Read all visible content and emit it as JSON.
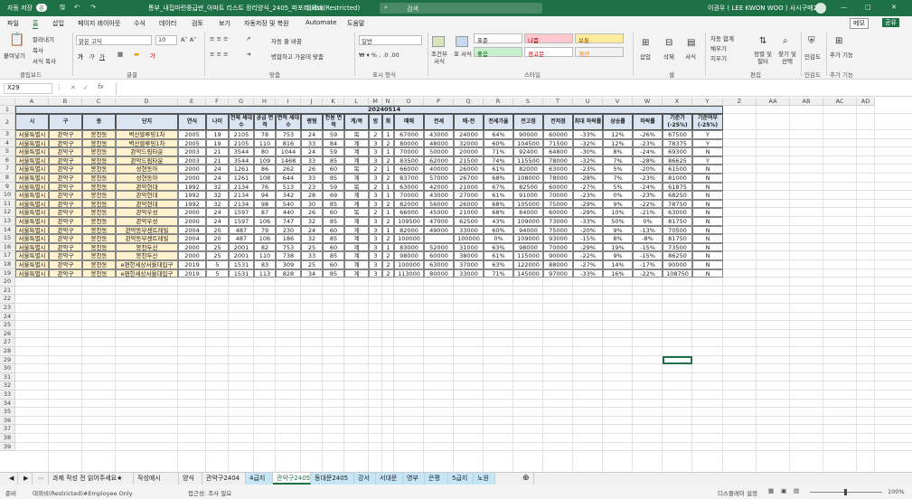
{
  "titlebar": {
    "autosave": "자동 저장",
    "autosave_state": "끔",
    "filename": "통부_내집마련중급반_아파트 리스트 정리양식_2405_파포리.xlsx",
    "label": "대외비(Restricted)",
    "search": "검색",
    "user": "이권우 ( LEE KWON WOO ) 사시구매2팀"
  },
  "tabs": [
    "파일",
    "홈",
    "삽입",
    "페이지 레이아웃",
    "수식",
    "데이터",
    "검토",
    "보기",
    "자동저장 및 복원",
    "Automate",
    "도움말"
  ],
  "tab_right": {
    "memo": "메모",
    "share": "공유"
  },
  "ribbon": {
    "paste": "붙여넣기",
    "cut": "잘라내기",
    "copy": "복사",
    "format_painter": "서식 복사",
    "font": "맑은 고딕",
    "font_size": "10",
    "wrap": "자동 줄 바꿈",
    "merge": "병합하고 가운데 맞춤",
    "number_format": "일반",
    "cond_format": "조건부 서식",
    "table_format": "표 서식",
    "cell_styles": [
      "표준",
      "나쁨",
      "보통",
      "좋음",
      "경고문",
      "계산"
    ],
    "insert": "삽입",
    "delete": "삭제",
    "format": "서식",
    "autosum": "자동 합계",
    "fill": "채우기",
    "clear": "지우기",
    "sort": "정렬 및 필터",
    "find": "찾기 및 선택",
    "sensitivity": "민감도",
    "addins": "추가 기능",
    "groups": [
      "클립보드",
      "글꼴",
      "맞춤",
      "표시 형식",
      "스타일",
      "셀",
      "편집",
      "민감도",
      "추가 기능"
    ]
  },
  "formula": {
    "namebox": "X29",
    "fx": "fx"
  },
  "columns": [
    "A",
    "B",
    "C",
    "D",
    "E",
    "F",
    "G",
    "H",
    "I",
    "J",
    "K",
    "L",
    "M",
    "N",
    "O",
    "P",
    "Q",
    "R",
    "S",
    "T",
    "U",
    "V",
    "W",
    "X",
    "Y",
    "Z",
    "AA",
    "AB",
    "AC",
    "AD"
  ],
  "rows": [
    "1",
    "2",
    "3",
    "4",
    "5",
    "6",
    "7",
    "8",
    "9",
    "10",
    "11",
    "12",
    "13",
    "14",
    "15",
    "16",
    "17",
    "18",
    "19",
    "20",
    "21",
    "22",
    "23",
    "24",
    "25",
    "26",
    "27",
    "28",
    "29",
    "30",
    "31",
    "32",
    "33",
    "34",
    "35",
    "36",
    "37",
    "38",
    "39"
  ],
  "date": "20240514",
  "header": [
    "시",
    "구",
    "동",
    "단지",
    "연식",
    "나이",
    "전체 세대수",
    "공급 면적",
    "면적 세대수",
    "평형",
    "전용 면적",
    "계/복",
    "방",
    "화",
    "매매",
    "전세",
    "매-전",
    "전세가율",
    "전고점",
    "전저점",
    "최대 하락률",
    "상승률",
    "하락률",
    "기준가 (-25%)",
    "기준여부 (-25%)"
  ],
  "data": [
    [
      "서울특별시",
      "관악구",
      "봉천동",
      "벽산블루밍1차",
      "2005",
      "19",
      "2105",
      "78",
      "753",
      "24",
      "59",
      "복",
      "2",
      "1",
      "67000",
      "43000",
      "24000",
      "64%",
      "90000",
      "60000",
      "-33%",
      "12%",
      "-26%",
      "67500",
      "Y"
    ],
    [
      "서울특별시",
      "관악구",
      "봉천동",
      "벽산블루밍1차",
      "2005",
      "19",
      "2105",
      "110",
      "816",
      "33",
      "84",
      "계",
      "3",
      "2",
      "80000",
      "48000",
      "32000",
      "60%",
      "104500",
      "71500",
      "-32%",
      "12%",
      "-23%",
      "78375",
      "Y"
    ],
    [
      "서울특별시",
      "관악구",
      "봉천동",
      "관악드림타운",
      "2003",
      "21",
      "3544",
      "80",
      "1044",
      "24",
      "59",
      "계",
      "3",
      "1",
      "70000",
      "50000",
      "20000",
      "71%",
      "92400",
      "64800",
      "-30%",
      "8%",
      "-24%",
      "69300",
      "N"
    ],
    [
      "서울특별시",
      "관악구",
      "봉천동",
      "관악드림타운",
      "2003",
      "21",
      "3544",
      "109",
      "1468",
      "33",
      "85",
      "계",
      "3",
      "2",
      "83500",
      "62000",
      "21500",
      "74%",
      "115500",
      "78000",
      "-32%",
      "7%",
      "-28%",
      "86625",
      "Y"
    ],
    [
      "서울특별시",
      "관악구",
      "봉천동",
      "성현동아",
      "2000",
      "24",
      "1261",
      "86",
      "262",
      "26",
      "60",
      "복",
      "2",
      "1",
      "66000",
      "40000",
      "26000",
      "61%",
      "82000",
      "63000",
      "-23%",
      "5%",
      "-20%",
      "61500",
      "N"
    ],
    [
      "서울특별시",
      "관악구",
      "봉천동",
      "성현동아",
      "2000",
      "24",
      "1261",
      "108",
      "644",
      "33",
      "85",
      "계",
      "3",
      "2",
      "83700",
      "57000",
      "26700",
      "68%",
      "108000",
      "78000",
      "-28%",
      "7%",
      "-23%",
      "81000",
      "N"
    ],
    [
      "서울특별시",
      "관악구",
      "봉천동",
      "관악현대",
      "1992",
      "32",
      "2134",
      "76",
      "513",
      "23",
      "59",
      "복",
      "2",
      "1",
      "63000",
      "42000",
      "21000",
      "67%",
      "82500",
      "60000",
      "-27%",
      "5%",
      "-24%",
      "61875",
      "N"
    ],
    [
      "서울특별시",
      "관악구",
      "봉천동",
      "관악현대",
      "1992",
      "32",
      "2134",
      "94",
      "342",
      "28",
      "69",
      "계",
      "3",
      "1",
      "70000",
      "43000",
      "27000",
      "61%",
      "91000",
      "70000",
      "-23%",
      "0%",
      "-23%",
      "68250",
      "N"
    ],
    [
      "서울특별시",
      "관악구",
      "봉천동",
      "관악현대",
      "1992",
      "32",
      "2134",
      "98",
      "540",
      "30",
      "85",
      "계",
      "3",
      "2",
      "82000",
      "56000",
      "26000",
      "68%",
      "105000",
      "75000",
      "-29%",
      "9%",
      "-22%",
      "78750",
      "N"
    ],
    [
      "서울특별시",
      "관악구",
      "봉천동",
      "관악우성",
      "2000",
      "24",
      "1597",
      "87",
      "440",
      "26",
      "60",
      "복",
      "2",
      "1",
      "66000",
      "45000",
      "21000",
      "68%",
      "84000",
      "60000",
      "-29%",
      "10%",
      "-21%",
      "63000",
      "N"
    ],
    [
      "서울특별시",
      "관악구",
      "봉천동",
      "관악우성",
      "2000",
      "24",
      "1597",
      "106",
      "747",
      "32",
      "85",
      "계",
      "3",
      "2",
      "109500",
      "47000",
      "62500",
      "43%",
      "109000",
      "73000",
      "-33%",
      "50%",
      "0%",
      "81750",
      "N"
    ],
    [
      "서울특별시",
      "관악구",
      "봉천동",
      "관악동부센트레빌",
      "2004",
      "20",
      "487",
      "79",
      "230",
      "24",
      "60",
      "계",
      "3",
      "1",
      "82000",
      "49000",
      "33000",
      "60%",
      "94000",
      "75000",
      "-20%",
      "9%",
      "-13%",
      "70500",
      "N"
    ],
    [
      "서울특별시",
      "관악구",
      "봉천동",
      "관악동부센트레빌",
      "2004",
      "20",
      "487",
      "106",
      "186",
      "32",
      "85",
      "계",
      "3",
      "2",
      "100000",
      "",
      "100000",
      "0%",
      "109000",
      "93000",
      "-15%",
      "8%",
      "-8%",
      "81750",
      "N"
    ],
    [
      "서울특별시",
      "관악구",
      "봉천동",
      "봉천두산",
      "2000",
      "25",
      "2001",
      "82",
      "753",
      "25",
      "60",
      "계",
      "3",
      "1",
      "83000",
      "52000",
      "31000",
      "63%",
      "98000",
      "70000",
      "-29%",
      "19%",
      "-15%",
      "73500",
      "N"
    ],
    [
      "서울특별시",
      "관악구",
      "봉천동",
      "봉천두산",
      "2000",
      "25",
      "2001",
      "110",
      "738",
      "33",
      "85",
      "계",
      "3",
      "2",
      "98000",
      "60000",
      "38000",
      "61%",
      "115000",
      "90000",
      "-22%",
      "9%",
      "-15%",
      "86250",
      "N"
    ],
    [
      "서울특별시",
      "관악구",
      "봉천동",
      "e편한세상서울대입구",
      "2019",
      "5",
      "1531",
      "83",
      "309",
      "25",
      "60",
      "계",
      "3",
      "2",
      "100000",
      "63000",
      "37000",
      "63%",
      "122000",
      "88000",
      "-27%",
      "14%",
      "-17%",
      "90000",
      "N"
    ],
    [
      "서울특별시",
      "관악구",
      "봉천동",
      "e편한세상서울대입구",
      "2019",
      "5",
      "1531",
      "113",
      "828",
      "34",
      "85",
      "계",
      "3",
      "2",
      "113000",
      "80000",
      "33000",
      "71%",
      "145000",
      "97000",
      "-33%",
      "16%",
      "-22%",
      "108750",
      "N"
    ]
  ],
  "sheet_tabs": [
    "과제 작성 전 읽어주세요★",
    "작성예시",
    "양식",
    "관악구2404",
    "4급지",
    "관악구2405",
    "동대문2405",
    "강서",
    "서대문",
    "영부",
    "은평",
    "5급지",
    "노원"
  ],
  "active_sheet": "관악구2405",
  "status": {
    "ready": "준비",
    "label": "대외비(Restricted)#Employee Only",
    "access": "접근성: 조사 필요",
    "display": "디스플레이 설정",
    "zoom": "100%"
  },
  "colors": {
    "accent": "#1e7145",
    "header_fill": "#fff2cc",
    "title_fill": "#dbe5f1"
  }
}
